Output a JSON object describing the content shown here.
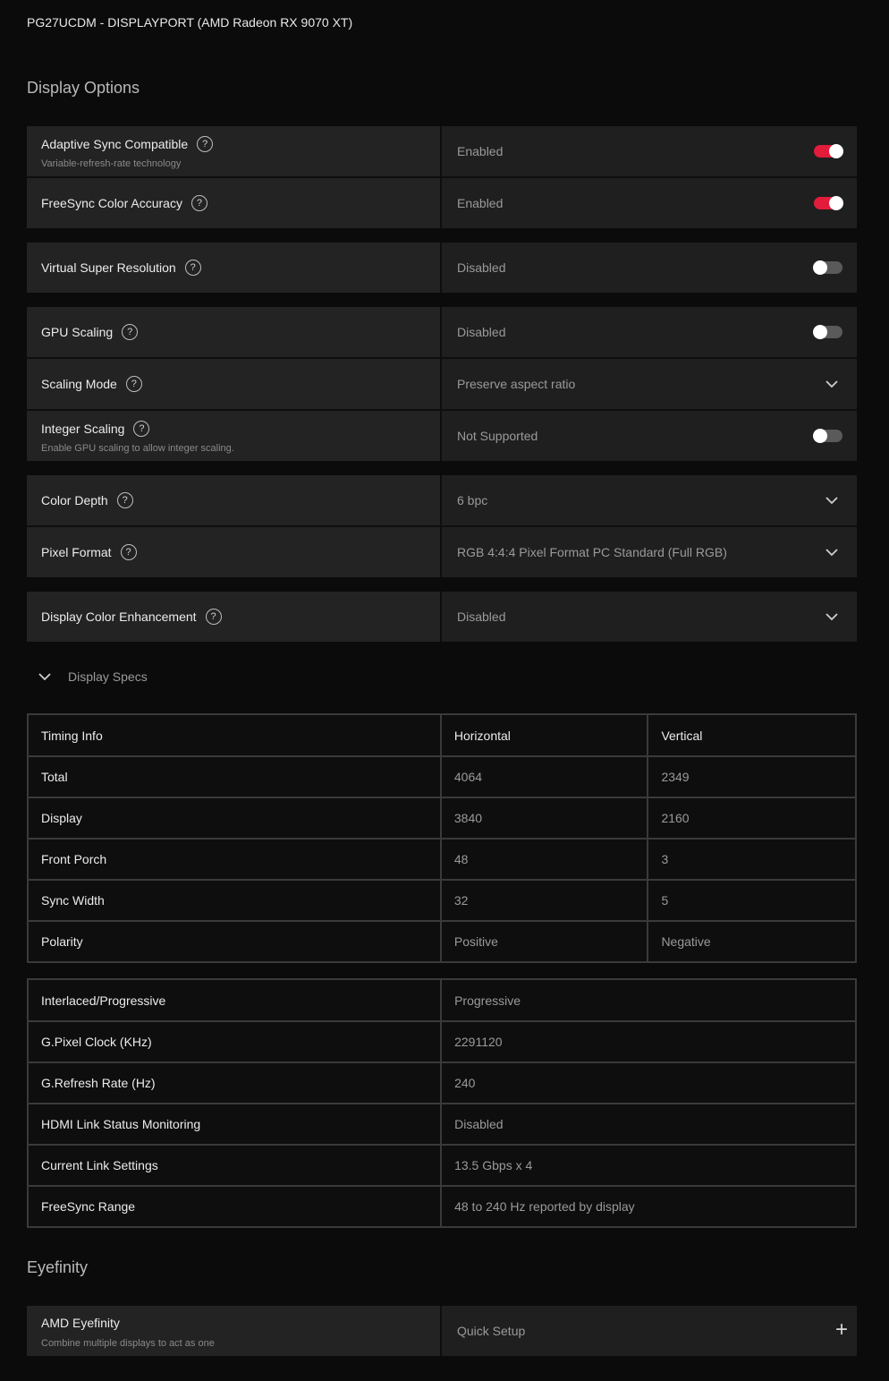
{
  "header": {
    "title": "PG27UCDM - DISPLAYPORT (AMD Radeon RX 9070 XT)"
  },
  "display_options": {
    "title": "Display Options",
    "adaptive_sync": {
      "label": "Adaptive Sync Compatible",
      "sub": "Variable-refresh-rate technology",
      "value": "Enabled",
      "state": "on"
    },
    "freesync_color": {
      "label": "FreeSync Color Accuracy",
      "value": "Enabled",
      "state": "on"
    },
    "vsr": {
      "label": "Virtual Super Resolution",
      "value": "Disabled",
      "state": "off"
    },
    "gpu_scaling": {
      "label": "GPU Scaling",
      "value": "Disabled",
      "state": "off"
    },
    "scaling_mode": {
      "label": "Scaling Mode",
      "value": "Preserve aspect ratio"
    },
    "integer_scaling": {
      "label": "Integer Scaling",
      "sub": "Enable GPU scaling to allow integer scaling.",
      "value": "Not Supported",
      "state": "off"
    },
    "color_depth": {
      "label": "Color Depth",
      "value": "6 bpc"
    },
    "pixel_format": {
      "label": "Pixel Format",
      "value": "RGB 4:4:4 Pixel Format PC Standard (Full RGB)"
    },
    "color_enhancement": {
      "label": "Display Color Enhancement",
      "value": "Disabled"
    }
  },
  "display_specs": {
    "title": "Display Specs",
    "timing": {
      "headers": [
        "Timing Info",
        "Horizontal",
        "Vertical"
      ],
      "rows": [
        [
          "Total",
          "4064",
          "2349"
        ],
        [
          "Display",
          "3840",
          "2160"
        ],
        [
          "Front Porch",
          "48",
          "3"
        ],
        [
          "Sync Width",
          "32",
          "5"
        ],
        [
          "Polarity",
          "Positive",
          "Negative"
        ]
      ]
    },
    "info": [
      [
        "Interlaced/Progressive",
        "Progressive"
      ],
      [
        "G.Pixel Clock (KHz)",
        "2291120"
      ],
      [
        "G.Refresh Rate (Hz)",
        "240"
      ],
      [
        "HDMI Link Status Monitoring",
        "Disabled"
      ],
      [
        "Current Link Settings",
        "13.5 Gbps x 4"
      ],
      [
        "FreeSync Range",
        "48 to 240 Hz reported by display"
      ]
    ]
  },
  "eyefinity": {
    "title": "Eyefinity",
    "label": "AMD Eyefinity",
    "sub": "Combine multiple displays to act as one",
    "value": "Quick Setup",
    "help_glyph": "?",
    "plus_glyph": "+"
  },
  "help_glyph": "?"
}
